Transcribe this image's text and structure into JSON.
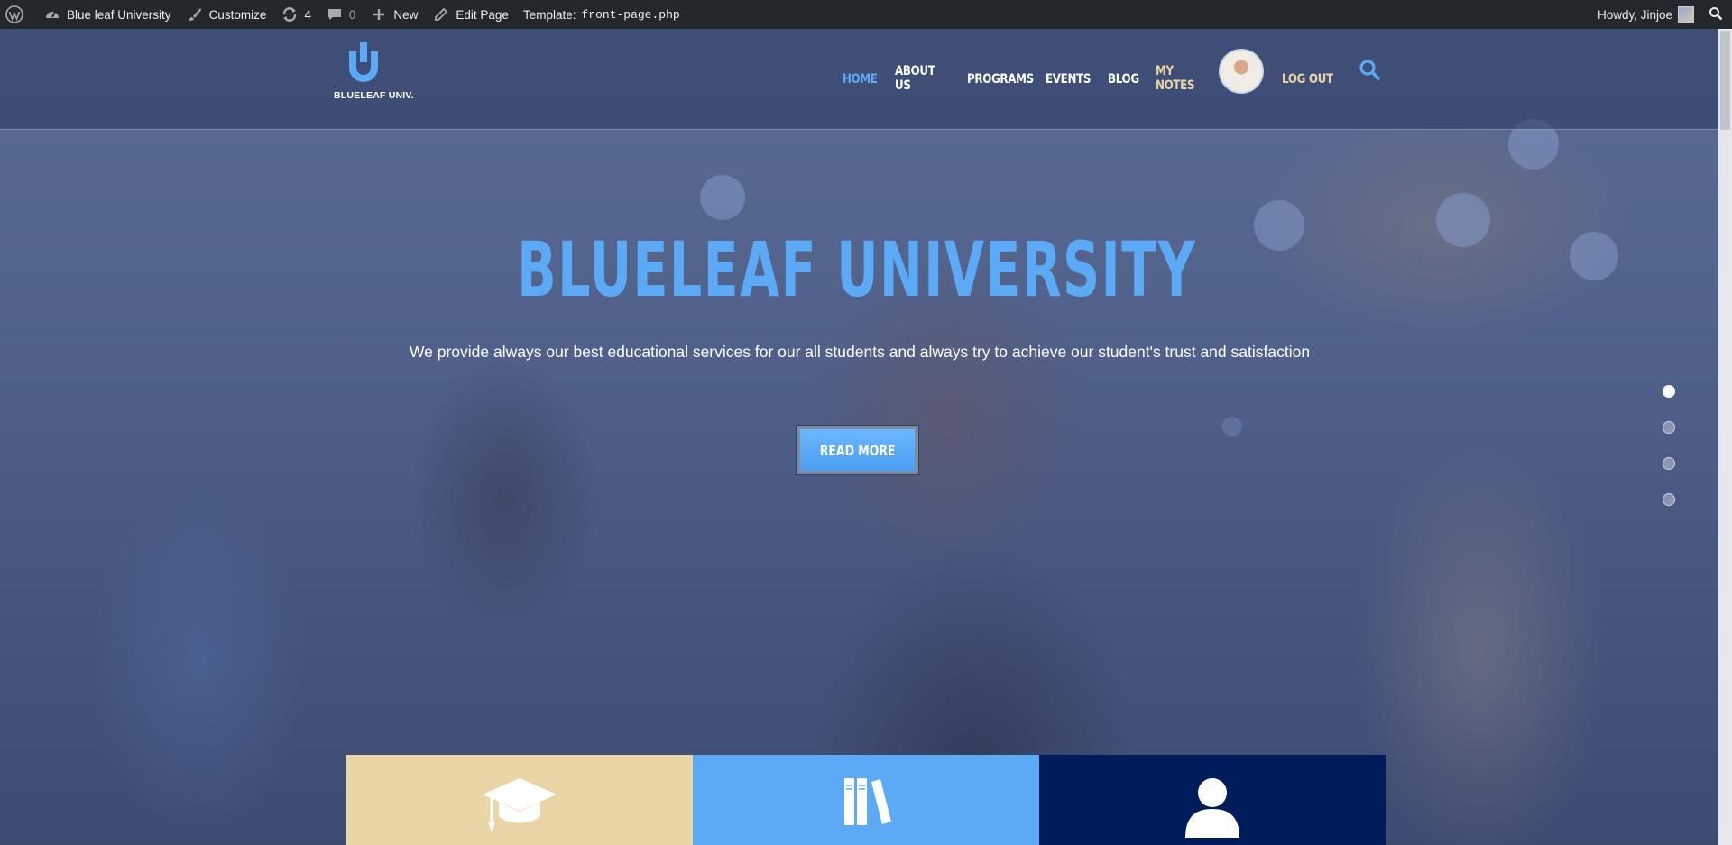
{
  "adminbar": {
    "site_name": "Blue leaf University",
    "customize": "Customize",
    "updates_count": "4",
    "comments_count": "0",
    "new": "New",
    "edit_page": "Edit Page",
    "template_label": "Template:",
    "template_file": "front-page.php",
    "howdy": "Howdy, Jinjoe"
  },
  "site": {
    "logo_text": "BLUELEAF UNIV.",
    "nav": [
      {
        "label": "HOME",
        "color": "#5caaf6"
      },
      {
        "label": "ABOUT US",
        "color": "#ffffff"
      },
      {
        "label": "PROGRAMS",
        "color": "#ffffff"
      },
      {
        "label": "EVENTS",
        "color": "#ffffff"
      },
      {
        "label": "BLOG",
        "color": "#ffffff"
      },
      {
        "label": "MY NOTES",
        "color": "#ead5a6"
      }
    ],
    "logout": "LOG OUT"
  },
  "hero": {
    "title": "BLUELEAF UNIVERSITY",
    "subtitle": "We provide always our best educational services for our all students and  always try to achieve our student's trust and satisfaction",
    "button": "READ MORE",
    "slides_total": 4,
    "active_slide": 1
  },
  "features": [
    {
      "icon": "graduation-cap-icon",
      "color": "#ead5a6"
    },
    {
      "icon": "books-icon",
      "color": "#5caaf6"
    },
    {
      "icon": "user-icon",
      "color": "#001c5a"
    }
  ],
  "colors": {
    "accent": "#5caaf6",
    "gold": "#ead5a6",
    "navy": "#001c5a",
    "adminbar": "#23282d"
  }
}
